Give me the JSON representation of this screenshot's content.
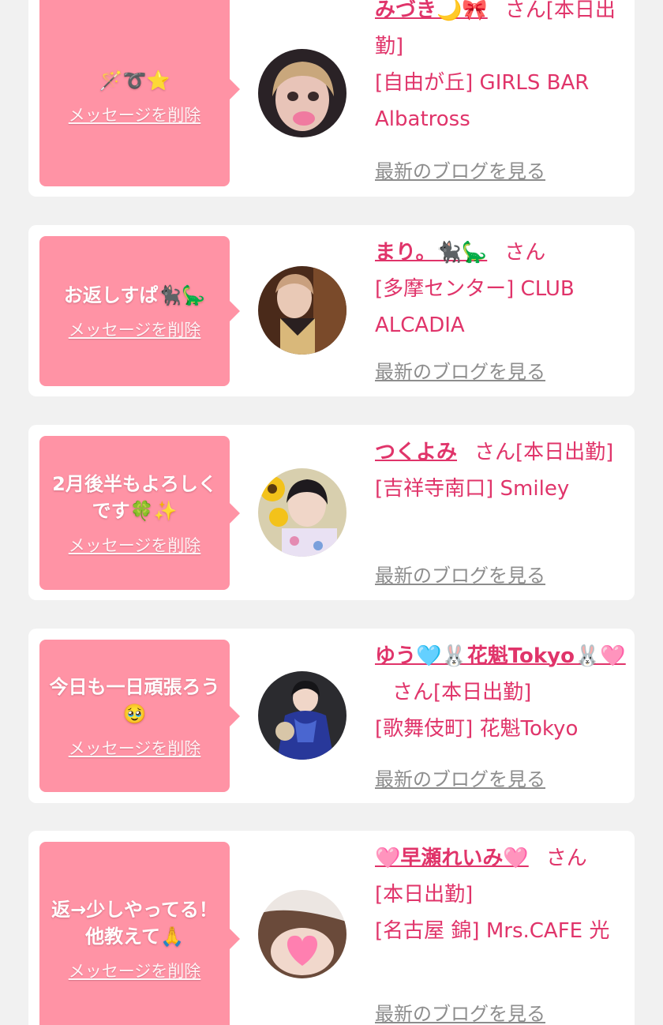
{
  "labels": {
    "delete_message": "メッセージを削除",
    "view_latest_blog": "最新のブログを見る",
    "honorific": "さん"
  },
  "colors": {
    "background": "#f1f1f1",
    "card": "#ffffff",
    "bubble": "#ff93a5",
    "accent": "#e0346a",
    "link_gray": "#8d8d8d"
  },
  "cards": [
    {
      "message": "🪄➰⭐️",
      "name": "みづき🌙🎀",
      "status": "[本日出勤]",
      "area_shop": "[自由が丘] GIRLS BAR Albatross",
      "avatar_icon": "avatar-photo"
    },
    {
      "message": "お返しすぱ🐈‍⬛🦕",
      "name": "まり。🐈‍⬛🦕",
      "status": "",
      "area_shop": "[多摩センター] CLUB ALCADIA",
      "avatar_icon": "avatar-photo"
    },
    {
      "message": "2月後半もよろしくです🍀✨",
      "name": "つくよみ",
      "status": "[本日出勤]",
      "area_shop": "[吉祥寺南口] Smiley",
      "avatar_icon": "avatar-photo"
    },
    {
      "message": "今日も一日頑張ろう🥹",
      "name": "ゆう🩵🐰花魁Tokyo🐰🩷",
      "status": "[本日出勤]",
      "area_shop": "[歌舞伎町] 花魁Tokyo",
      "avatar_icon": "avatar-photo"
    },
    {
      "message": "返→少しやってる！他教えて🙏",
      "name": "🩷早瀬れいみ🩷",
      "status": "[本日出勤]",
      "area_shop": "[名古屋 錦] Mrs.CAFE 光",
      "avatar_icon": "avatar-photo"
    }
  ]
}
